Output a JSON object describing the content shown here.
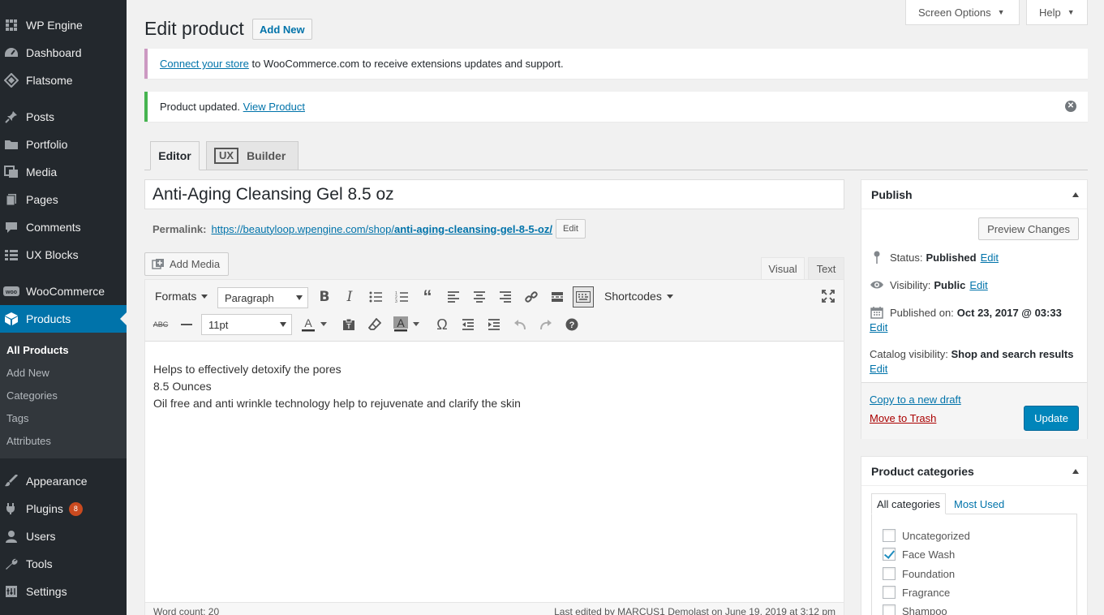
{
  "sidebar": {
    "items": [
      {
        "label": "WP Engine",
        "icon": "wpengine-icon"
      },
      {
        "label": "Dashboard",
        "icon": "dashboard-icon"
      },
      {
        "label": "Flatsome",
        "icon": "flatsome-icon"
      },
      {
        "label": "Posts",
        "icon": "pin-icon"
      },
      {
        "label": "Portfolio",
        "icon": "folder-icon"
      },
      {
        "label": "Media",
        "icon": "media-icon"
      },
      {
        "label": "Pages",
        "icon": "pages-icon"
      },
      {
        "label": "Comments",
        "icon": "comment-icon"
      },
      {
        "label": "UX Blocks",
        "icon": "blocks-icon"
      },
      {
        "label": "WooCommerce",
        "icon": "woo-icon"
      },
      {
        "label": "Products",
        "icon": "cube-icon"
      },
      {
        "label": "Appearance",
        "icon": "brush-icon"
      },
      {
        "label": "Plugins",
        "icon": "plug-icon",
        "badge": "8"
      },
      {
        "label": "Users",
        "icon": "user-icon"
      },
      {
        "label": "Tools",
        "icon": "wrench-icon"
      },
      {
        "label": "Settings",
        "icon": "settings-icon"
      }
    ],
    "submenu": [
      "All Products",
      "Add New",
      "Categories",
      "Tags",
      "Attributes"
    ]
  },
  "header": {
    "screen_options": "Screen Options",
    "help": "Help",
    "title": "Edit product",
    "add_new": "Add New"
  },
  "notices": {
    "connect_link": "Connect your store",
    "connect_text": " to WooCommerce.com to receive extensions updates and support.",
    "updated_text": "Product updated. ",
    "view_product": "View Product"
  },
  "editor_tabs": {
    "editor": "Editor",
    "ux_logo": "UX",
    "builder": "Builder"
  },
  "post": {
    "title": "Anti-Aging Cleansing Gel 8.5 oz",
    "permalink_label": "Permalink:",
    "permalink_base": "https://beautyloop.wpengine.com/shop/",
    "permalink_slug": "anti-aging-cleansing-gel-8-5-oz/",
    "permalink_edit": "Edit"
  },
  "media": {
    "add_media": "Add Media",
    "visual": "Visual",
    "text": "Text"
  },
  "toolbar": {
    "formats": "Formats",
    "paragraph": "Paragraph",
    "shortcodes": "Shortcodes",
    "font_size": "11pt"
  },
  "content": {
    "lines": [
      "Helps to effectively detoxify the pores",
      "8.5 Ounces",
      "Oil free and anti wrinkle technology help to rejuvenate and clarify the skin"
    ],
    "word_count": "Word count: 20",
    "last_edited": "Last edited by MARCUS1 Demolast on June 19, 2019 at 3:12 pm"
  },
  "publish": {
    "title": "Publish",
    "preview": "Preview Changes",
    "status_label": "Status:",
    "status_value": "Published",
    "visibility_label": "Visibility:",
    "visibility_value": "Public",
    "published_label": "Published on:",
    "published_value": "Oct 23, 2017 @ 03:33",
    "catalog_label": "Catalog visibility:",
    "catalog_value": "Shop and search results",
    "edit": "Edit",
    "copy_draft": "Copy to a new draft",
    "trash": "Move to Trash",
    "update": "Update"
  },
  "categories": {
    "title": "Product categories",
    "tab_all": "All categories",
    "tab_most": "Most Used",
    "items": [
      {
        "label": "Uncategorized",
        "checked": false
      },
      {
        "label": "Face Wash",
        "checked": true
      },
      {
        "label": "Foundation",
        "checked": false
      },
      {
        "label": "Fragrance",
        "checked": false
      },
      {
        "label": "Shampoo",
        "checked": false
      }
    ]
  },
  "colors": {
    "accent": "#0073aa",
    "sidebar": "#23282d",
    "update": "#0085ba",
    "badge": "#ca4a1f",
    "trash": "#aa0000"
  }
}
